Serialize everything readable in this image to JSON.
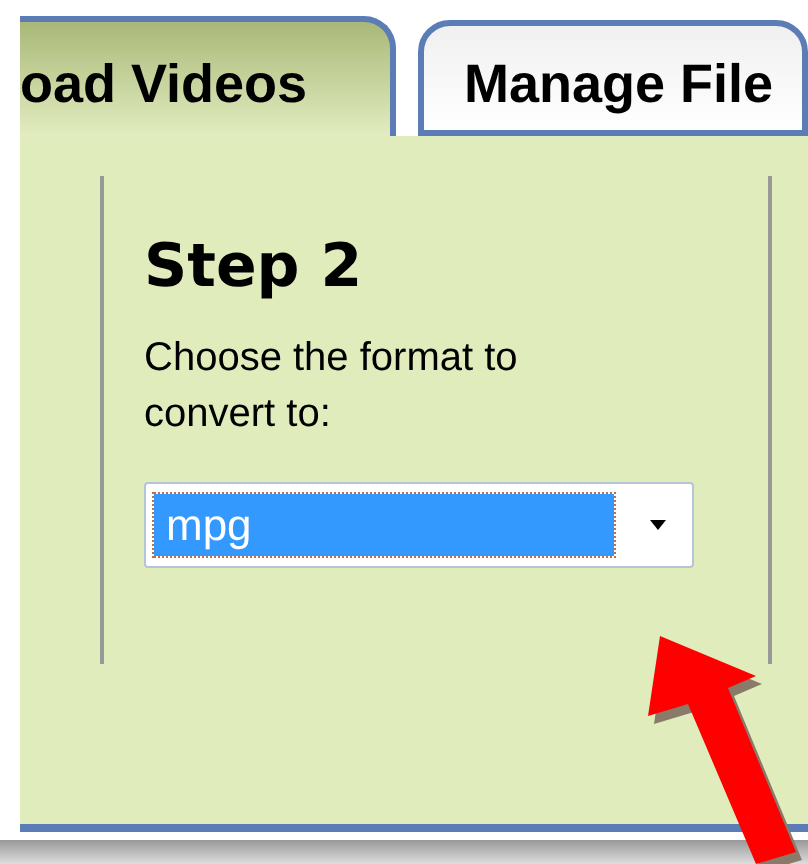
{
  "tabs": [
    {
      "label": "oad Videos",
      "selected": true
    },
    {
      "label": "Manage File",
      "selected": false
    }
  ],
  "step": {
    "title": "Step 2",
    "instruction": "Choose the format to convert to:"
  },
  "format_select": {
    "value": "mpg",
    "highlighted": true
  }
}
